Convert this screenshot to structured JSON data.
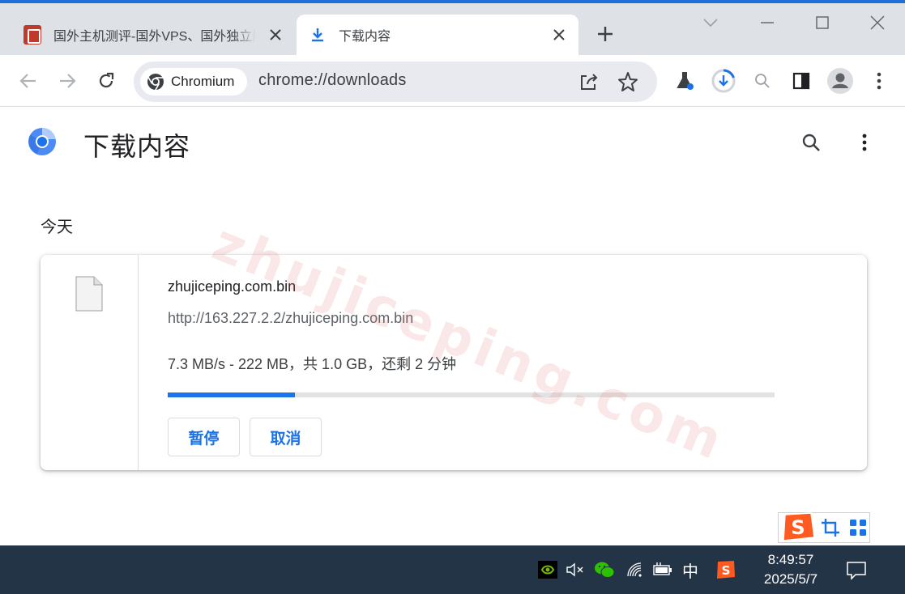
{
  "browser": {
    "tabs": [
      {
        "title": "国外主机测评-国外VPS、国外独立服务器",
        "active": false
      },
      {
        "title": "下载内容",
        "active": true
      }
    ],
    "omnibox": {
      "chip_label": "Chromium",
      "url": "chrome://downloads"
    }
  },
  "page": {
    "title": "下载内容",
    "date_header": "今天",
    "watermark": "zhujiceping.com",
    "downloads": [
      {
        "file_name": "zhujiceping.com.bin",
        "url": "http://163.227.2.2/zhujiceping.com.bin",
        "status": "7.3 MB/s - 222 MB，共 1.0 GB，还剩 2 分钟",
        "progress_percent": 21,
        "pause_label": "暂停",
        "cancel_label": "取消"
      }
    ]
  },
  "taskbar": {
    "ime_label": "中",
    "time": "8:49:57",
    "date": "2025/5/7"
  },
  "colors": {
    "accent": "#1a73e8",
    "tabstrip": "#dee1e6",
    "taskbar": "#243447"
  }
}
